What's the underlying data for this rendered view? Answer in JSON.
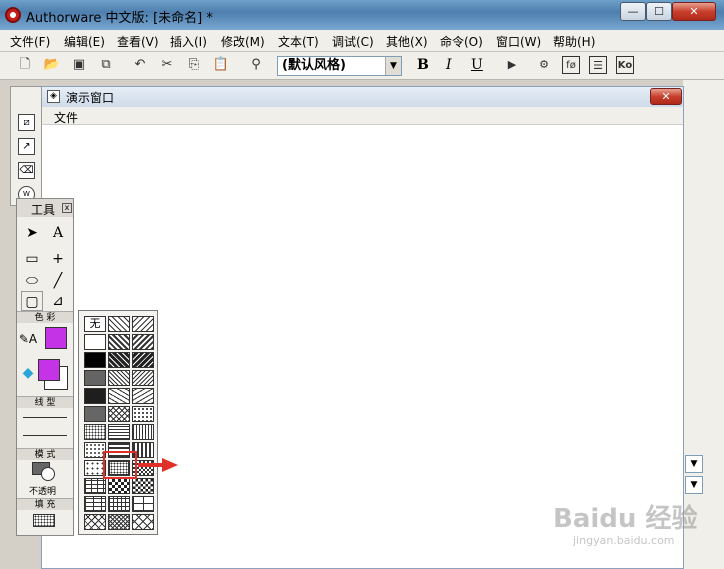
{
  "window": {
    "title": "Authorware 中文版: [未命名] *",
    "min_glyph": "—",
    "max_glyph": "☐",
    "close_glyph": "✕"
  },
  "menu": [
    "文件(F)",
    "编辑(E)",
    "查看(V)",
    "插入(I)",
    "修改(M)",
    "文本(T)",
    "调试(C)",
    "其他(X)",
    "命令(O)",
    "窗口(W)",
    "帮助(H)"
  ],
  "toolbar": {
    "icons": [
      "new-file-icon",
      "open-icon",
      "save-all-icon",
      "import-icon",
      "undo-icon",
      "cut-icon",
      "copy-icon",
      "paste-icon",
      "find-icon"
    ],
    "style_select_value": "(默认风格)",
    "bold": "B",
    "italic": "I",
    "underline": "U",
    "run_icons": [
      "restart-icon",
      "control-panel-icon",
      "function-icon",
      "variable-icon",
      "knowledge-object-icon"
    ],
    "run_labels": [
      "▶",
      "⚙",
      "fø",
      "☰",
      "Ko"
    ]
  },
  "presentation": {
    "title": "演示窗口",
    "menu_file": "文件",
    "close_glyph": "✕"
  },
  "tools": {
    "title": "工具",
    "close_glyph": "x",
    "color_label": "色 彩",
    "line_label": "线 型",
    "mode_label": "模 式",
    "mode_value": "不透明",
    "fill_label": "填 充",
    "colors": {
      "magenta": "#c433e6",
      "white": "#ffffff"
    }
  },
  "patterns": {
    "none_label": "无",
    "selected_row": 8,
    "selected_col": 1
  },
  "watermark": {
    "text": "Baidu 经验",
    "sub": "jingyan.baidu.com"
  }
}
